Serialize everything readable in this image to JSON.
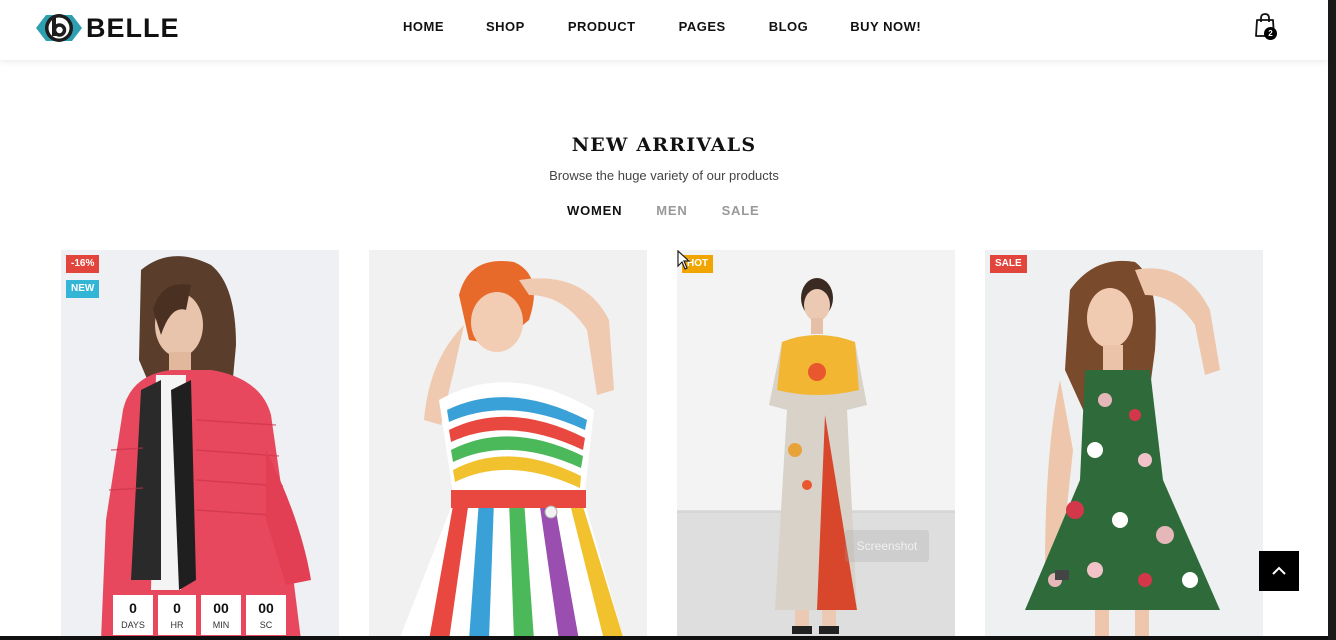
{
  "header": {
    "brand": "BELLE",
    "nav": [
      "HOME",
      "SHOP",
      "PRODUCT",
      "PAGES",
      "BLOG",
      "BUY NOW!"
    ],
    "cart_count": "2",
    "cart_icon": "shopping-bag-icon"
  },
  "section": {
    "title": "NEW ARRIVALS",
    "subtitle": "Browse the huge variety of our products",
    "tabs": [
      "WOMEN",
      "MEN",
      "SALE"
    ],
    "active_tab": "WOMEN"
  },
  "products": [
    {
      "badges": [
        "-16%",
        "NEW"
      ],
      "countdown": {
        "days": "0",
        "days_label": "DAYS",
        "hours": "0",
        "hours_label": "HR",
        "minutes": "00",
        "minutes_label": "MIN",
        "seconds": "00",
        "seconds_label": "SC"
      }
    },
    {
      "badges": []
    },
    {
      "badges": [
        "HOT"
      ],
      "tooltip": "Screenshot"
    },
    {
      "badges": [
        "SALE"
      ]
    }
  ],
  "colors": {
    "accent_teal": "#33b5d6",
    "badge_red": "#e2453c",
    "badge_yellow": "#f0a500"
  },
  "back_to_top_icon": "chevron-up-icon"
}
